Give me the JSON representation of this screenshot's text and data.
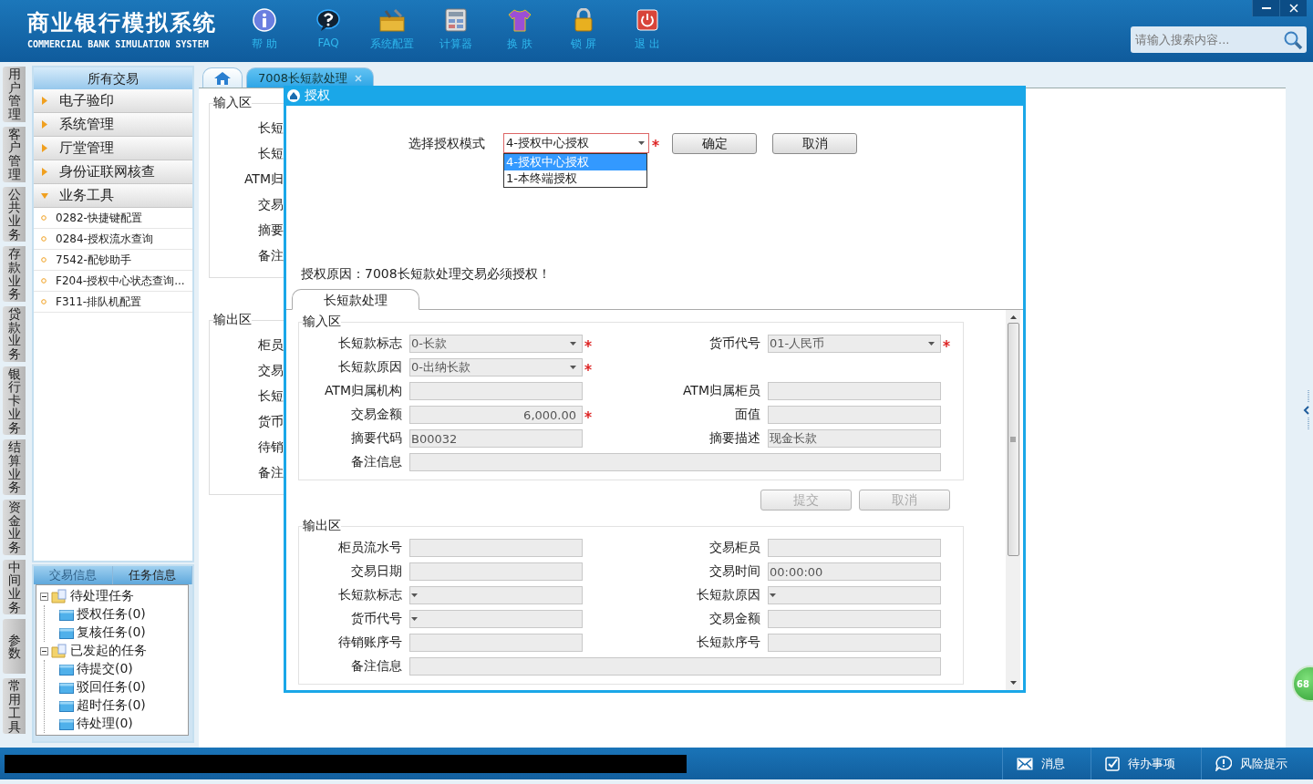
{
  "header": {
    "title": "商业银行模拟系统",
    "subtitle": "COMMERCIAL BANK SIMULATION SYSTEM",
    "toolbar": [
      {
        "kind": "info",
        "label": "帮 助"
      },
      {
        "kind": "faq",
        "label": "FAQ"
      },
      {
        "kind": "config",
        "label": "系统配置"
      },
      {
        "kind": "calculator",
        "label": "计算器"
      },
      {
        "kind": "skin",
        "label": "换 肤"
      },
      {
        "kind": "lock",
        "label": "锁 屏"
      },
      {
        "kind": "exit",
        "label": "退 出"
      }
    ],
    "search": {
      "placeholder": "请输入搜索内容..."
    }
  },
  "side_tabs": [
    "用户管理",
    "客户管理",
    "公共业务",
    "存款业务",
    "贷款业务",
    "银行卡业务",
    "结算业务",
    "资金业务",
    "中间业务",
    "参数",
    "常用工具"
  ],
  "nav": {
    "title": "所有交易",
    "groups": [
      {
        "label": "电子验印",
        "expanded": false
      },
      {
        "label": "系统管理",
        "expanded": false
      },
      {
        "label": "厅堂管理",
        "expanded": false
      },
      {
        "label": "身份证联网核查",
        "expanded": false
      },
      {
        "label": "业务工具",
        "expanded": true,
        "children": [
          "0282-快捷键配置",
          "0284-授权流水查询",
          "7542-配钞助手",
          "F204-授权中心状态查询...",
          "F311-排队机配置"
        ]
      }
    ]
  },
  "task_panel": {
    "tabs": [
      {
        "label": "交易信息",
        "selected": false
      },
      {
        "label": "任务信息",
        "selected": true
      }
    ],
    "tree": [
      {
        "label": "待处理任务",
        "expanded": true,
        "children": [
          {
            "label": "授权任务(0)"
          },
          {
            "label": "复核任务(0)"
          }
        ]
      },
      {
        "label": "已发起的任务",
        "expanded": true,
        "children": [
          {
            "label": "待提交(0)"
          },
          {
            "label": "驳回任务(0)"
          },
          {
            "label": "超时任务(0)"
          },
          {
            "label": "待处理(0)"
          }
        ]
      }
    ]
  },
  "content_tabs": [
    {
      "kind": "home",
      "selected": false
    },
    {
      "kind": "page",
      "label": "7008长短款处理",
      "selected": true,
      "closable": true
    }
  ],
  "background_form": {
    "input_legend": "输入区",
    "input_labels": [
      "长短",
      "长短",
      "ATM归",
      "交易",
      "摘要",
      "备注"
    ],
    "output_legend": "输出区",
    "output_labels": [
      "柜员",
      "交易",
      "长短",
      "货币",
      "待销",
      "备注"
    ]
  },
  "dialog": {
    "title": "授权",
    "mode_label": "选择授权模式",
    "mode_select": {
      "value": "4-授权中心授权",
      "required": true,
      "open": true,
      "options": [
        {
          "label": "4-授权中心授权",
          "selected": true
        },
        {
          "label": "1-本终端授权",
          "selected": false
        }
      ]
    },
    "buttons": [
      "确定",
      "取消"
    ],
    "reason": "授权原因：7008长短款处理交易必须授权！",
    "tab": {
      "label": "长短款处理",
      "selected": true
    },
    "input_section": {
      "legend": "输入区",
      "rows": [
        [
          {
            "label": "长短款标志",
            "kind": "select",
            "value": "0-长款",
            "required": true
          },
          {
            "label": "货币代号",
            "kind": "select",
            "value": "01-人民币",
            "required": true
          }
        ],
        [
          {
            "label": "长短款原因",
            "kind": "select",
            "value": "0-出纳长款",
            "required": true
          }
        ],
        [
          {
            "label": "ATM归属机构",
            "kind": "text"
          },
          {
            "label": "ATM归属柜员",
            "kind": "text"
          }
        ],
        [
          {
            "label": "交易金额",
            "kind": "amount",
            "value": "6,000.00",
            "required": true
          },
          {
            "label": "面值",
            "kind": "text"
          }
        ],
        [
          {
            "label": "摘要代码",
            "kind": "text",
            "value": "B00032"
          },
          {
            "label": "摘要描述",
            "kind": "text",
            "value": "现金长款"
          }
        ],
        [
          {
            "label": "备注信息",
            "kind": "wide"
          }
        ]
      ]
    },
    "actions": [
      {
        "label": "提交",
        "disabled": true
      },
      {
        "label": "取消",
        "disabled": true
      }
    ],
    "output_section": {
      "legend": "输出区",
      "rows": [
        [
          {
            "label": "柜员流水号",
            "kind": "text"
          },
          {
            "label": "交易柜员",
            "kind": "text"
          }
        ],
        [
          {
            "label": "交易日期",
            "kind": "text"
          },
          {
            "label": "交易时间",
            "kind": "text",
            "value": "00:00:00"
          }
        ],
        [
          {
            "label": "长短款标志",
            "kind": "select"
          },
          {
            "label": "长短款原因",
            "kind": "select"
          }
        ],
        [
          {
            "label": "货币代号",
            "kind": "select"
          },
          {
            "label": "交易金额",
            "kind": "text"
          }
        ],
        [
          {
            "label": "待销账序号",
            "kind": "text"
          },
          {
            "label": "长短款序号",
            "kind": "text"
          }
        ],
        [
          {
            "label": "备注信息",
            "kind": "wide"
          }
        ]
      ]
    }
  },
  "footer": {
    "items": [
      {
        "kind": "message",
        "label": "消息"
      },
      {
        "kind": "todo",
        "label": "待办事项"
      },
      {
        "kind": "risk",
        "label": "风险提示"
      }
    ]
  },
  "badge": "68"
}
